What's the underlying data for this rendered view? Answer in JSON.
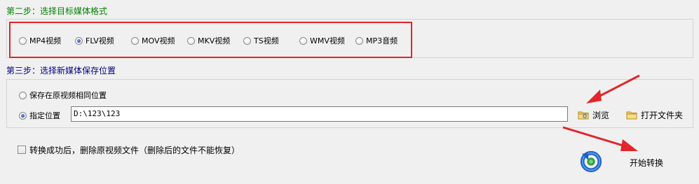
{
  "step2": {
    "title": "第二步：选择目标媒体格式",
    "formats": [
      {
        "label": "MP4视频",
        "checked": false
      },
      {
        "label": "FLV视频",
        "checked": true
      },
      {
        "label": "MOV视频",
        "checked": false
      },
      {
        "label": "MKV视频",
        "checked": false
      },
      {
        "label": "TS视频",
        "checked": false
      },
      {
        "label": "WMV视频",
        "checked": false
      },
      {
        "label": "MP3音频",
        "checked": false
      }
    ]
  },
  "step3": {
    "title": "第三步：选择新媒体保存位置",
    "same_location_label": "保存在原视频相同位置",
    "same_location_checked": false,
    "custom_location_label": "指定位置",
    "custom_location_checked": true,
    "path_value": "D:\\123\\123",
    "browse_label": "浏览",
    "open_folder_label": "打开文件夹"
  },
  "options": {
    "delete_source_label": "转换成功后，删除原视频文件（删除后的文件不能恢复）",
    "delete_source_checked": false
  },
  "start_button_label": "开始转换",
  "colors": {
    "step2_title": "#008000",
    "step3_title": "#000080",
    "highlight": "#e0262b",
    "refresh_icon": "#1b5fc9"
  }
}
